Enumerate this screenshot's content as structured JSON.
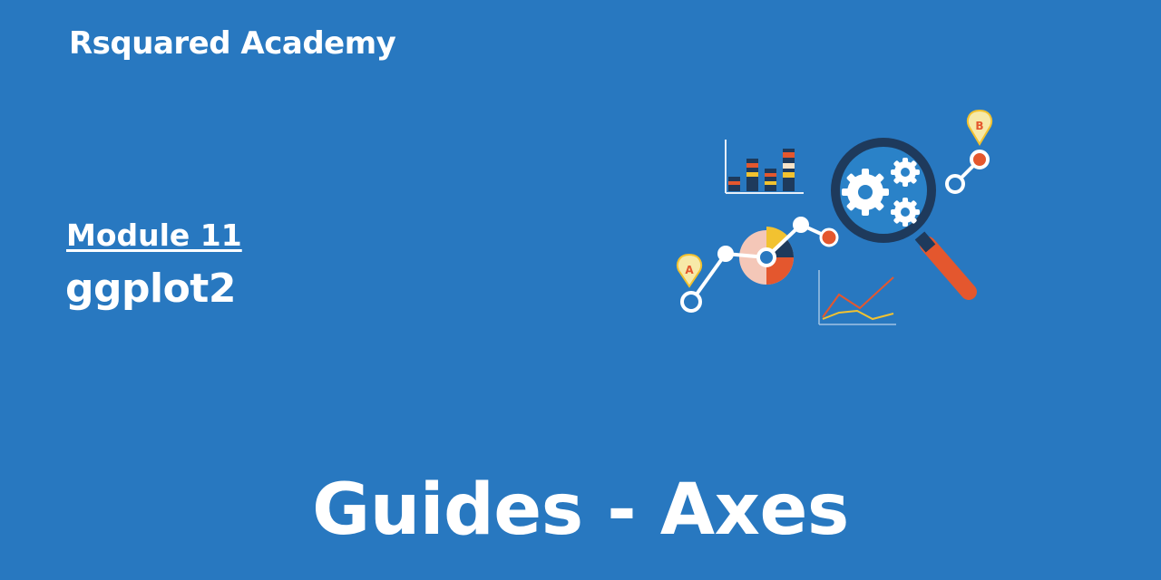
{
  "brand": "Rsquared Academy",
  "module_label": "Module 11",
  "subject": "ggplot2",
  "heading": "Guides - Axes",
  "illustration": {
    "marker_a": "A",
    "marker_b": "B"
  },
  "colors": {
    "background": "#2878c0",
    "text": "#ffffff",
    "accent_orange": "#e4572e",
    "accent_yellow": "#f2c230",
    "dark_navy": "#1e3a5c"
  }
}
